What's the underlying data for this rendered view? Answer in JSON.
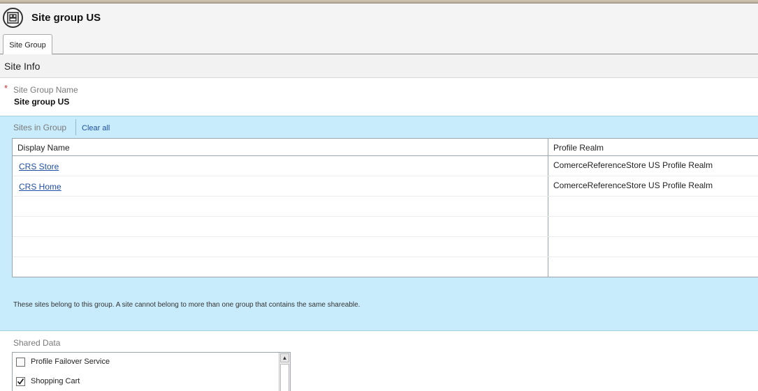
{
  "header": {
    "title": "Site group US",
    "logo_icon": "site-group-icon"
  },
  "tabs": [
    {
      "label": "Site Group",
      "active": true
    }
  ],
  "section": {
    "title": "Site Info"
  },
  "site_group_name": {
    "label": "Site Group Name",
    "value": "Site group US",
    "required_mark": "*"
  },
  "sites_in_group": {
    "label": "Sites in Group",
    "clear_all_label": "Clear all",
    "columns": [
      "Display Name",
      "Profile Realm"
    ],
    "rows": [
      {
        "display_name": "CRS Store",
        "profile_realm": "ComerceReferenceStore US Profile Realm"
      },
      {
        "display_name": "CRS Home",
        "profile_realm": "ComerceReferenceStore US Profile Realm"
      }
    ],
    "info_text": "These sites belong to this group. A site cannot belong to more than one group that contains the same shareable."
  },
  "shared_data": {
    "label": "Shared Data",
    "items": [
      {
        "label": "Profile Failover Service",
        "checked": false
      },
      {
        "label": "Shopping Cart",
        "checked": true
      }
    ]
  },
  "colors": {
    "panel_bg": "#c8ecfc",
    "link": "#1f4fa0",
    "required": "#cc3333"
  }
}
